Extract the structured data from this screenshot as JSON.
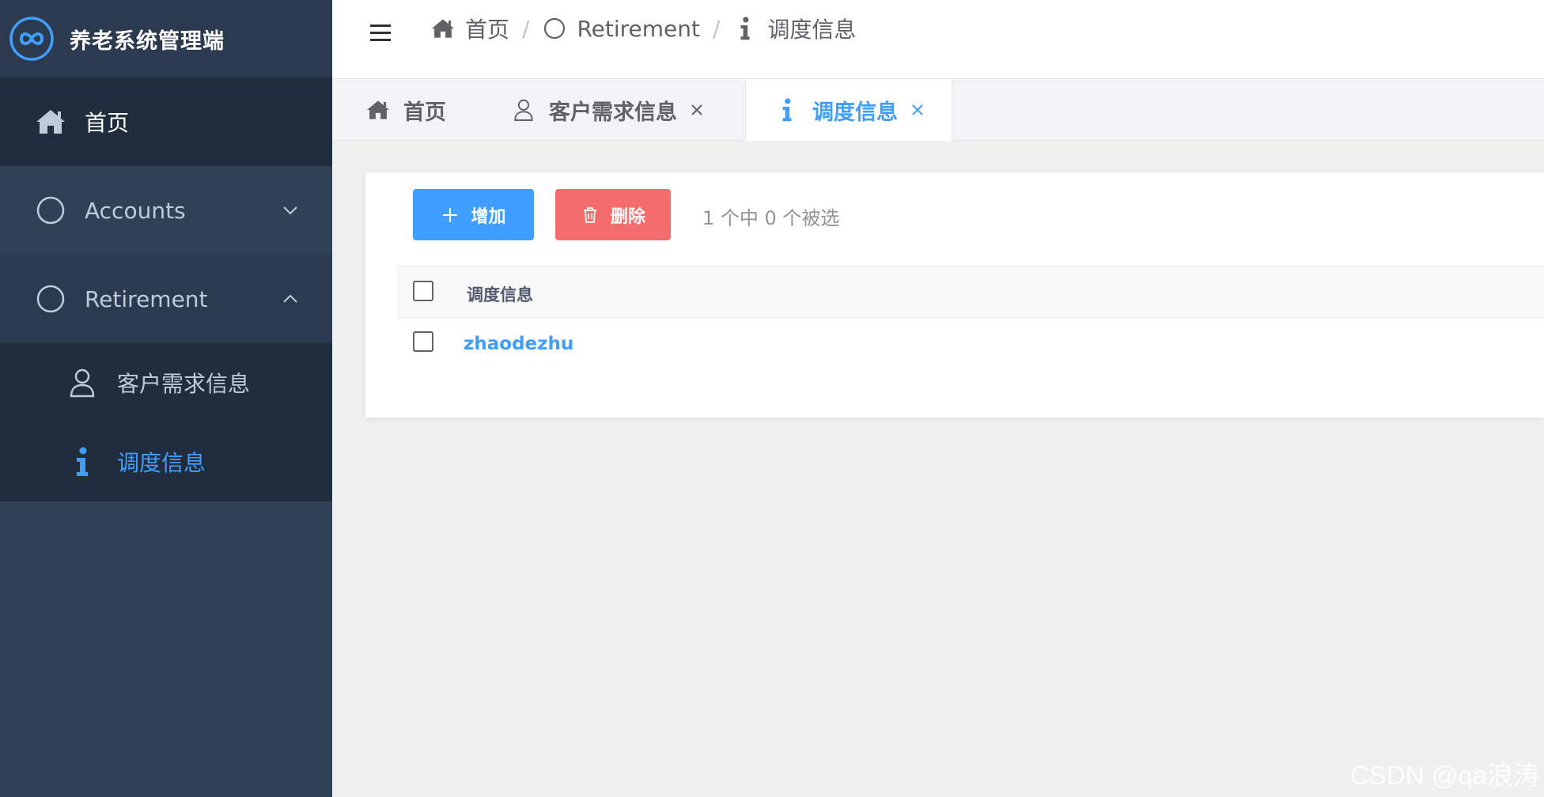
{
  "app": {
    "title": "养老系统管理端"
  },
  "sidebar": {
    "items": [
      {
        "label": "首页",
        "icon": "home-icon"
      },
      {
        "label": "Accounts",
        "icon": "circle-icon"
      },
      {
        "label": "Retirement",
        "icon": "circle-icon"
      }
    ],
    "subitems": [
      {
        "label": "客户需求信息",
        "icon": "user-icon"
      },
      {
        "label": "调度信息",
        "icon": "info-icon"
      }
    ]
  },
  "breadcrumb": {
    "items": [
      "首页",
      "Retirement",
      "调度信息"
    ],
    "separator": "/"
  },
  "tabs": [
    {
      "label": "首页"
    },
    {
      "label": "客户需求信息"
    },
    {
      "label": "调度信息"
    }
  ],
  "toolbar": {
    "add_label": "增加",
    "delete_label": "删除",
    "selection_text": "1 个中 0 个被选"
  },
  "table": {
    "header": "调度信息",
    "rows": [
      {
        "value": "zhaodezhu"
      }
    ]
  },
  "watermark": "CSDN @qa浪涛",
  "colors": {
    "accent": "#409eff",
    "danger": "#f56c6c",
    "sidebar_bg": "#304156",
    "sidebar_dark": "#1f2d3d"
  }
}
